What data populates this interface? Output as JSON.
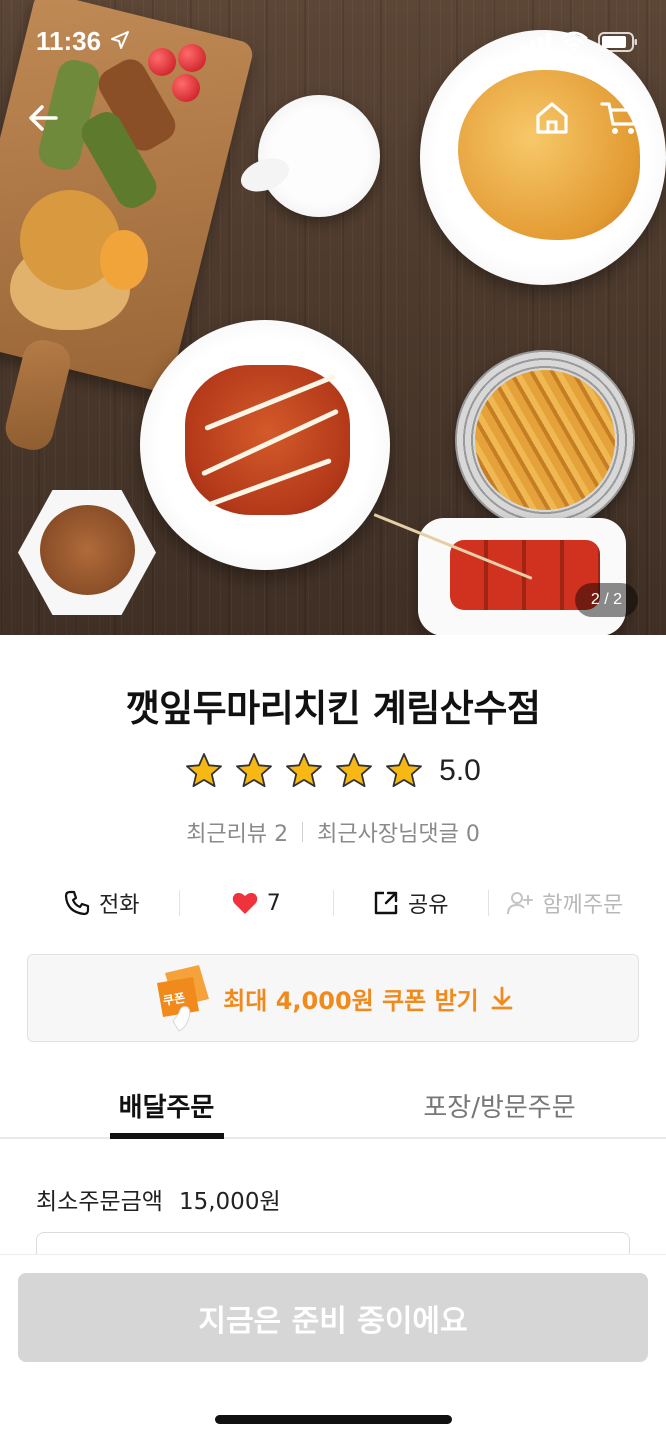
{
  "status_bar": {
    "time": "11:36"
  },
  "hero": {
    "counter": "2 / 2"
  },
  "store": {
    "name": "깻잎두마리치킨 계림산수점",
    "rating": "5.0",
    "stars_filled": 5,
    "recent_reviews": "최근리뷰 2",
    "owner_comments": "최근사장님댓글 0"
  },
  "actions": {
    "call_label": "전화",
    "like_count": "7",
    "share_label": "공유",
    "group_order_label": "함께주문"
  },
  "coupon": {
    "icon_text": "쿠폰",
    "label": "최대 4,000원 쿠폰 받기"
  },
  "tabs": [
    {
      "label": "배달주문",
      "active": true
    },
    {
      "label": "포장/방문주문",
      "active": false
    }
  ],
  "delivery": {
    "min_order_label": "최소주문금액",
    "min_order_value": "15,000원"
  },
  "bottom": {
    "order_button": "지금은 준비 중이에요"
  },
  "colors": {
    "accent": "#f08a1c",
    "heart": "#f0323c",
    "disabled_button": "#d6d6d6",
    "star": "#f8b814"
  }
}
